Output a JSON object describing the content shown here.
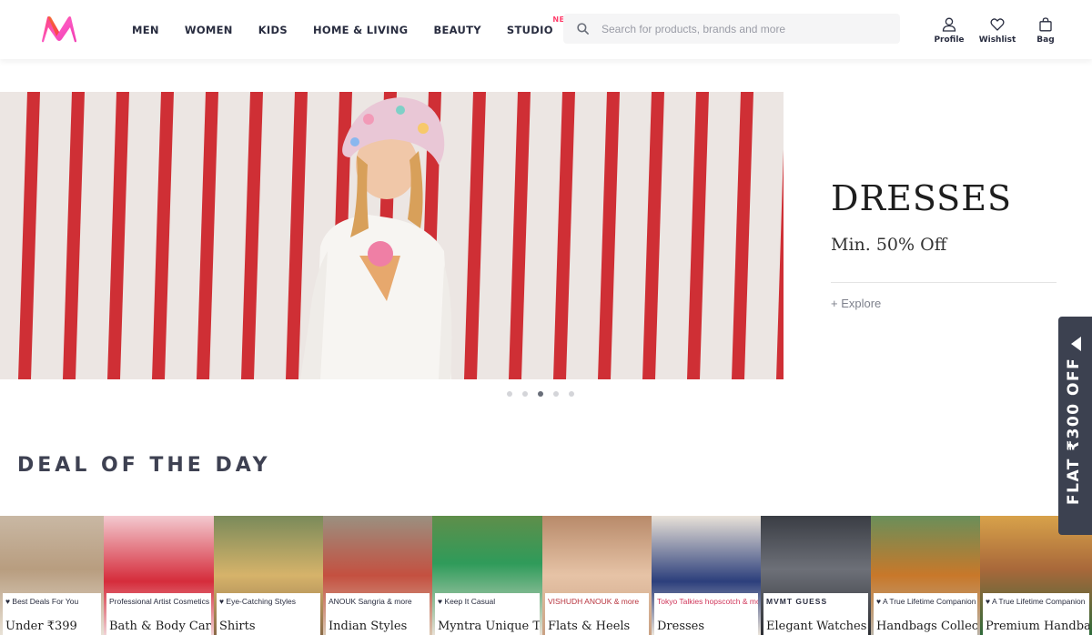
{
  "header": {
    "logo": "myntra-logo",
    "nav": [
      {
        "label": "MEN"
      },
      {
        "label": "WOMEN"
      },
      {
        "label": "KIDS"
      },
      {
        "label": "HOME & LIVING"
      },
      {
        "label": "BEAUTY"
      },
      {
        "label": "STUDIO",
        "badge": "NEW"
      }
    ],
    "search": {
      "placeholder": "Search for products, brands and more",
      "value": "",
      "icon": "search-icon"
    },
    "actions": [
      {
        "label": "Profile",
        "icon": "profile-icon"
      },
      {
        "label": "Wishlist",
        "icon": "heart-icon"
      },
      {
        "label": "Bag",
        "icon": "bag-icon"
      }
    ]
  },
  "hero": {
    "title": "DRESSES",
    "subtitle": "Min. 50% Off",
    "cta": "+ Explore",
    "slides_total": 5,
    "active_slide": 3
  },
  "deal": {
    "title": "DEAL OF THE DAY",
    "cards": [
      {
        "brand": "♥ Best Deals For You",
        "title": "Under ₹399"
      },
      {
        "brand": "Professional Artist Cosmetics",
        "title": "Bath & Body Care"
      },
      {
        "brand": "♥ Eye-Catching Styles",
        "title": "Shirts"
      },
      {
        "brand": "ANOUK  Sangria  & more",
        "title": "Indian Styles"
      },
      {
        "brand": "♥ Keep It Casual",
        "title": "Myntra Unique T-Shirts"
      },
      {
        "brand": "VISHUDH  ANOUK  & more",
        "title": "Flats & Heels"
      },
      {
        "brand": "Tokyo Talkies  hopscotch  & more",
        "title": "Dresses"
      },
      {
        "brand": "MVMT  GUESS",
        "title": "Elegant Watches"
      },
      {
        "brand": "♥ A True Lifetime Companion",
        "title": "Handbags Collection"
      },
      {
        "brand": "♥ A True Lifetime Companion",
        "title": "Premium Handbags"
      }
    ]
  },
  "side_tab": {
    "label": "FLAT ₹300 OFF",
    "icon": "arrow-left-icon"
  },
  "colors": {
    "brand_pink": "#ff3f6c",
    "text": "#282c3f",
    "side_tab": "#3c4150"
  }
}
